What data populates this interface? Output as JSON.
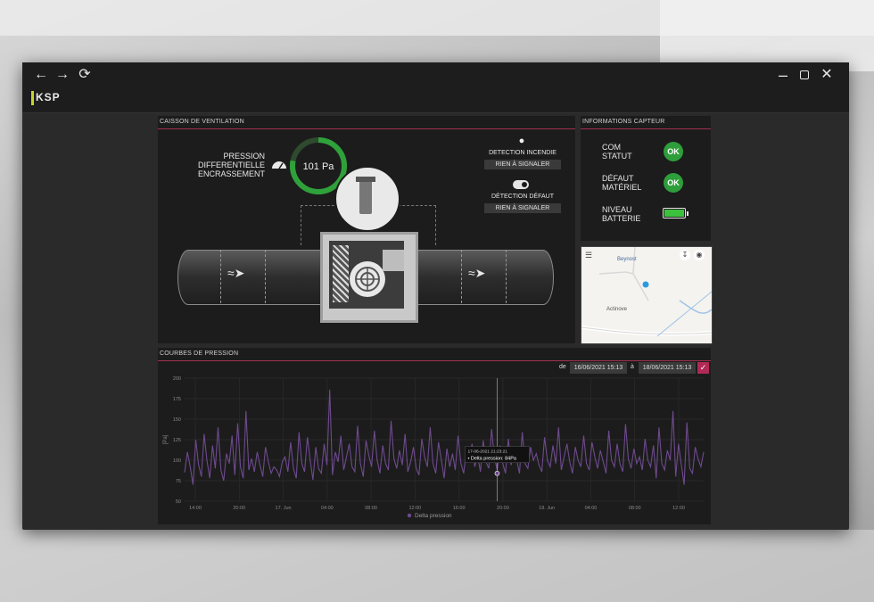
{
  "window": {
    "nav": {
      "back_icon": "arrow-left-icon",
      "forward_icon": "arrow-right-icon",
      "refresh_icon": "refresh-icon"
    },
    "controls": {
      "minimize_icon": "minimize-icon",
      "maximize_icon": "maximize-icon",
      "close_icon": "close-icon"
    },
    "logo": "KSP"
  },
  "caisson": {
    "title": "CAISSON DE VENTILATION",
    "pressure_label": [
      "PRESSION",
      "DIFFERENTIELLE",
      "ENCRASSEMENT"
    ],
    "gauge_value": "101 Pa",
    "gauge_fraction": 0.78,
    "fire_label": "DETECTION INCENDIE",
    "fire_status": "RIEN À SIGNALER",
    "fault_label": "DÉTECTION DÉFAUT",
    "fault_status": "RIEN À SIGNALER"
  },
  "sensor": {
    "title": "INFORMATIONS CAPTEUR",
    "rows": [
      {
        "label": [
          "COM",
          "STATUT"
        ],
        "value": "OK"
      },
      {
        "label": [
          "DÉFAUT",
          "MATÉRIEL"
        ],
        "value": "OK"
      },
      {
        "label": [
          "NIVEAU",
          "BATTERIE"
        ],
        "value": ""
      }
    ],
    "battery_level": 1.0
  },
  "map": {
    "labels": [
      "Beynost",
      "Actinove"
    ],
    "menu_icon": "menu-icon",
    "download_icon": "download-icon",
    "eye_icon": "eye-icon"
  },
  "curves": {
    "title": "COURBES DE PRESSION",
    "from_label": "de",
    "from_value": "16/06/2021 15:13",
    "to_label": "à",
    "to_value": "18/06/2021 15:13",
    "confirm_icon": "check-icon"
  },
  "chart_data": {
    "type": "line",
    "ylabel": "[Pa]",
    "ylim": [
      50,
      200
    ],
    "yticks": [
      200,
      175,
      150,
      125,
      100,
      75,
      50
    ],
    "xticks": [
      "14:00",
      "20:00",
      "17. Jun",
      "04:00",
      "08:00",
      "12:00",
      "16:00",
      "20:00",
      "18. Jun",
      "04:00",
      "08:00",
      "12:00"
    ],
    "series": [
      {
        "name": "Delta pression",
        "color": "#6e4a8e",
        "values": [
          85,
          110,
          92,
          70,
          125,
          95,
          80,
          132,
          100,
          78,
          118,
          90,
          140,
          88,
          75,
          108,
          96,
          130,
          82,
          145,
          92,
          78,
          160,
          88,
          102,
          86,
          110,
          94,
          80,
          116,
          98,
          84,
          92,
          88,
          80,
          98,
          104,
          86,
          122,
          90,
          78,
          134,
          96,
          86,
          128,
          100,
          76,
          116,
          90,
          84,
          120,
          94,
          186,
          82,
          110,
          98,
          130,
          88,
          104,
          120,
          92,
          86,
          142,
          96,
          80,
          124,
          106,
          92,
          136,
          100,
          84,
          118,
          96,
          88,
          148,
          102,
          90,
          112,
          94,
          132,
          86,
          98,
          116,
          90,
          82,
          126,
          104,
          92,
          140,
          96,
          84,
          122,
          100,
          78,
          114,
          92,
          108,
          88,
          130,
          96,
          84,
          112,
          100,
          120,
          92,
          106,
          86,
          124,
          98,
          90,
          138,
          104,
          88,
          118,
          96,
          84,
          126,
          94,
          110,
          100,
          84,
          134,
          96,
          90,
          116,
          100,
          108,
          94,
          86,
          128,
          100,
          92,
          118,
          96,
          140,
          88,
          104,
          120,
          98,
          84,
          116,
          100,
          92,
          130,
          96,
          88,
          122,
          104,
          90,
          112,
          98,
          84,
          136,
          100,
          92,
          120,
          96,
          86,
          144,
          102,
          90,
          114,
          96,
          104,
          88,
          126,
          100,
          92,
          118,
          78,
          140,
          96,
          88,
          112,
          100,
          160,
          80,
          120,
          94,
          70,
          146,
          90,
          84,
          116,
          102,
          92,
          110
        ]
      }
    ],
    "tooltip": {
      "time": "17-06-2021 21:23:21",
      "text": "Delta pression: 84Pa"
    }
  }
}
